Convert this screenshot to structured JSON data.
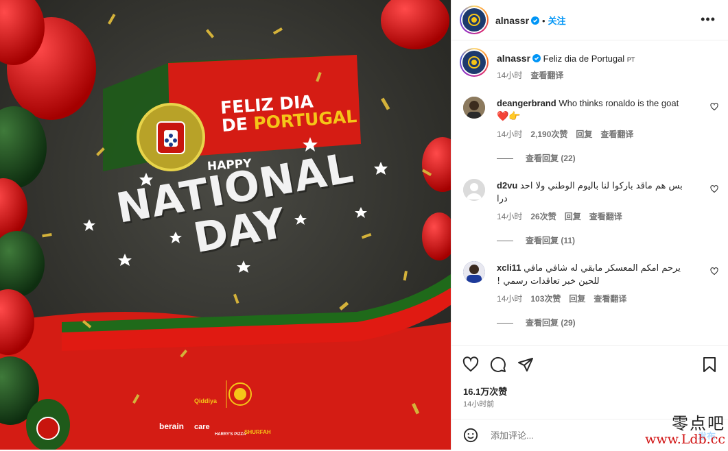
{
  "post": {
    "media": {
      "headline_line1": "FELIZ DIA",
      "headline_de": "DE ",
      "headline_portugal": "PORTUGAL",
      "happy": "HAPPY",
      "national": "NATIONAL",
      "day": "DAY",
      "sponsor_qiddiya": "Qiddiya",
      "sponsor_berain": "berain",
      "sponsor_care": "care",
      "sponsor_harrys": "HARRY'S PIZZA",
      "sponsor_shurfah": "SHURFAH"
    },
    "header": {
      "username": "alnassr",
      "follow_label": "关注",
      "more_label": "•••"
    },
    "caption": {
      "username": "alnassr",
      "text": "Feliz dia de Portugal",
      "flag_text": "PT",
      "time": "14小时",
      "translate": "查看翻译"
    },
    "comments": [
      {
        "username": "deangerbrand",
        "text": "Who thinks ronaldo is the goat",
        "emoji": "❤️👉",
        "time": "14小时",
        "likes": "2,190次赞",
        "reply": "回复",
        "translate": "查看翻译",
        "view_replies": "查看回复 (22)"
      },
      {
        "username": "d2vu",
        "text": "بس هم ماقد باركوا لنا باليوم الوطني ولا احد درا",
        "time": "14小时",
        "likes": "26次赞",
        "reply": "回复",
        "translate": "查看翻译",
        "view_replies": "查看回复 (11)"
      },
      {
        "username": "xcli11",
        "text": "يرحم امكم المعسكر مابقي له شافي مافي للحين خبر تعاقدات رسمي !",
        "time": "14小时",
        "likes": "103次赞",
        "reply": "回复",
        "translate": "查看翻译",
        "view_replies": "查看回复 (29)"
      }
    ],
    "actions": {
      "likes": "16.1万次赞",
      "time_ago": "14小时前"
    },
    "add_comment": {
      "placeholder": "添加评论...",
      "post_label": "发布"
    },
    "watermark": {
      "chinese": "零点吧",
      "url": "www.Ldb.cc"
    }
  }
}
